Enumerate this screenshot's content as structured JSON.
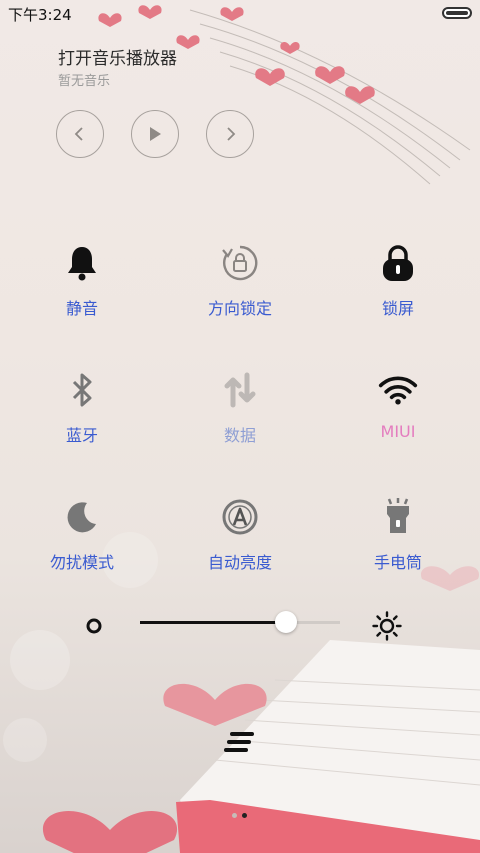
{
  "status_bar": {
    "time": "下午3:24"
  },
  "music": {
    "title": "打开音乐播放器",
    "subtitle": "暂无音乐",
    "prev_icon": "chevron-left-icon",
    "play_icon": "play-icon",
    "next_icon": "chevron-right-icon"
  },
  "toggles": [
    {
      "label": "静音",
      "icon": "bell-icon",
      "state": "on"
    },
    {
      "label": "方向锁定",
      "icon": "rotation-lock-icon",
      "state": "off"
    },
    {
      "label": "锁屏",
      "icon": "lock-icon",
      "state": "on"
    },
    {
      "label": "蓝牙",
      "icon": "bluetooth-icon",
      "state": "off"
    },
    {
      "label": "数据",
      "icon": "data-sync-icon",
      "state": "disabled"
    },
    {
      "label": "MIUI",
      "icon": "wifi-icon",
      "state": "connected"
    },
    {
      "label": "勿扰模式",
      "icon": "moon-icon",
      "state": "off"
    },
    {
      "label": "自动亮度",
      "icon": "auto-brightness-icon",
      "state": "off"
    },
    {
      "label": "手电筒",
      "icon": "flashlight-icon",
      "state": "off"
    }
  ],
  "brightness": {
    "level": 0.73,
    "min_icon": "brightness-low-icon",
    "max_icon": "brightness-high-icon"
  },
  "pager": {
    "pages": 2,
    "current": 2
  },
  "colors": {
    "label_blue": "#3a5bd0",
    "label_pink": "#e47dbf",
    "icon_dark": "#111111",
    "icon_gray": "#777777"
  }
}
